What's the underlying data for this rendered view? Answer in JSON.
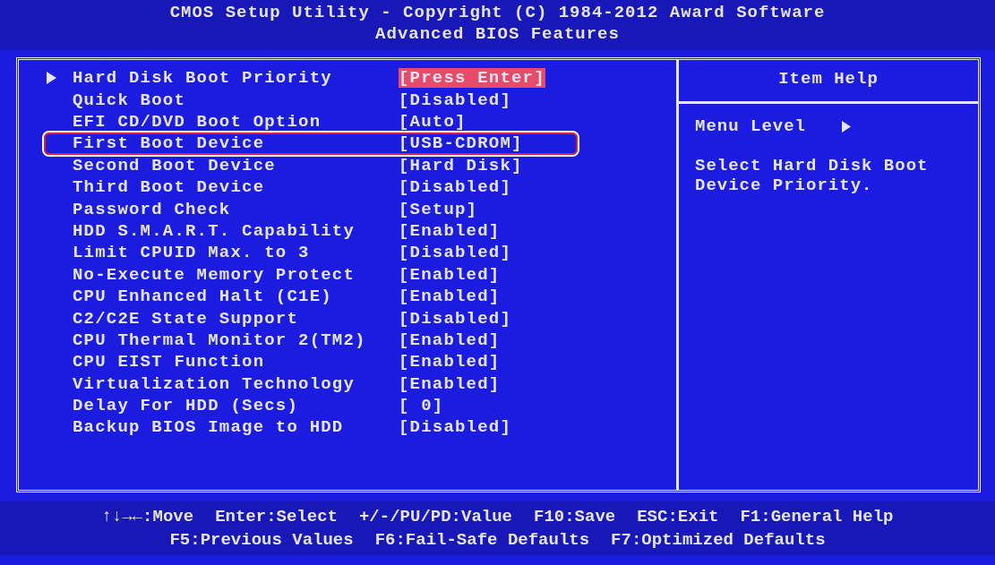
{
  "header": {
    "title": "CMOS Setup Utility - Copyright (C) 1984-2012 Award Software",
    "subtitle": "Advanced BIOS Features"
  },
  "settings": [
    {
      "label": "Hard Disk Boot Priority",
      "value": "[Press Enter]",
      "selected": true,
      "submenu": true,
      "marked": false
    },
    {
      "label": "Quick Boot",
      "value": "[Disabled]",
      "selected": false,
      "submenu": false,
      "marked": false
    },
    {
      "label": "EFI CD/DVD Boot Option",
      "value": "[Auto]",
      "selected": false,
      "submenu": false,
      "marked": false
    },
    {
      "label": "First Boot Device",
      "value": "[USB-CDROM]",
      "selected": false,
      "submenu": false,
      "marked": true
    },
    {
      "label": "Second Boot Device",
      "value": "[Hard Disk]",
      "selected": false,
      "submenu": false,
      "marked": false
    },
    {
      "label": "Third Boot Device",
      "value": "[Disabled]",
      "selected": false,
      "submenu": false,
      "marked": false
    },
    {
      "label": "Password Check",
      "value": "[Setup]",
      "selected": false,
      "submenu": false,
      "marked": false
    },
    {
      "label": "HDD S.M.A.R.T. Capability",
      "value": "[Enabled]",
      "selected": false,
      "submenu": false,
      "marked": false
    },
    {
      "label": "Limit CPUID Max. to 3",
      "value": "[Disabled]",
      "selected": false,
      "submenu": false,
      "marked": false
    },
    {
      "label": "No-Execute Memory Protect",
      "value": "[Enabled]",
      "selected": false,
      "submenu": false,
      "marked": false
    },
    {
      "label": "CPU Enhanced Halt (C1E)",
      "value": "[Enabled]",
      "selected": false,
      "submenu": false,
      "marked": false
    },
    {
      "label": "C2/C2E State Support",
      "value": "[Disabled]",
      "selected": false,
      "submenu": false,
      "marked": false
    },
    {
      "label": "CPU Thermal Monitor 2(TM2)",
      "value": "[Enabled]",
      "selected": false,
      "submenu": false,
      "marked": false
    },
    {
      "label": "CPU EIST Function",
      "value": "[Enabled]",
      "selected": false,
      "submenu": false,
      "marked": false
    },
    {
      "label": "Virtualization Technology",
      "value": "[Enabled]",
      "selected": false,
      "submenu": false,
      "marked": false
    },
    {
      "label": "Delay For HDD (Secs)",
      "value": "[ 0]",
      "selected": false,
      "submenu": false,
      "marked": false
    },
    {
      "label": "Backup BIOS Image to HDD",
      "value": "[Disabled]",
      "selected": false,
      "submenu": false,
      "marked": false
    }
  ],
  "help": {
    "title": "Item Help",
    "menu_level": "Menu Level",
    "text": "Select Hard Disk Boot Device Priority."
  },
  "footer": [
    [
      "↑↓→←:Move",
      "Enter:Select",
      "+/-/PU/PD:Value",
      "F10:Save",
      "ESC:Exit",
      "F1:General Help"
    ],
    [
      "F5:Previous Values",
      "F6:Fail-Safe Defaults",
      "F7:Optimized Defaults"
    ]
  ]
}
